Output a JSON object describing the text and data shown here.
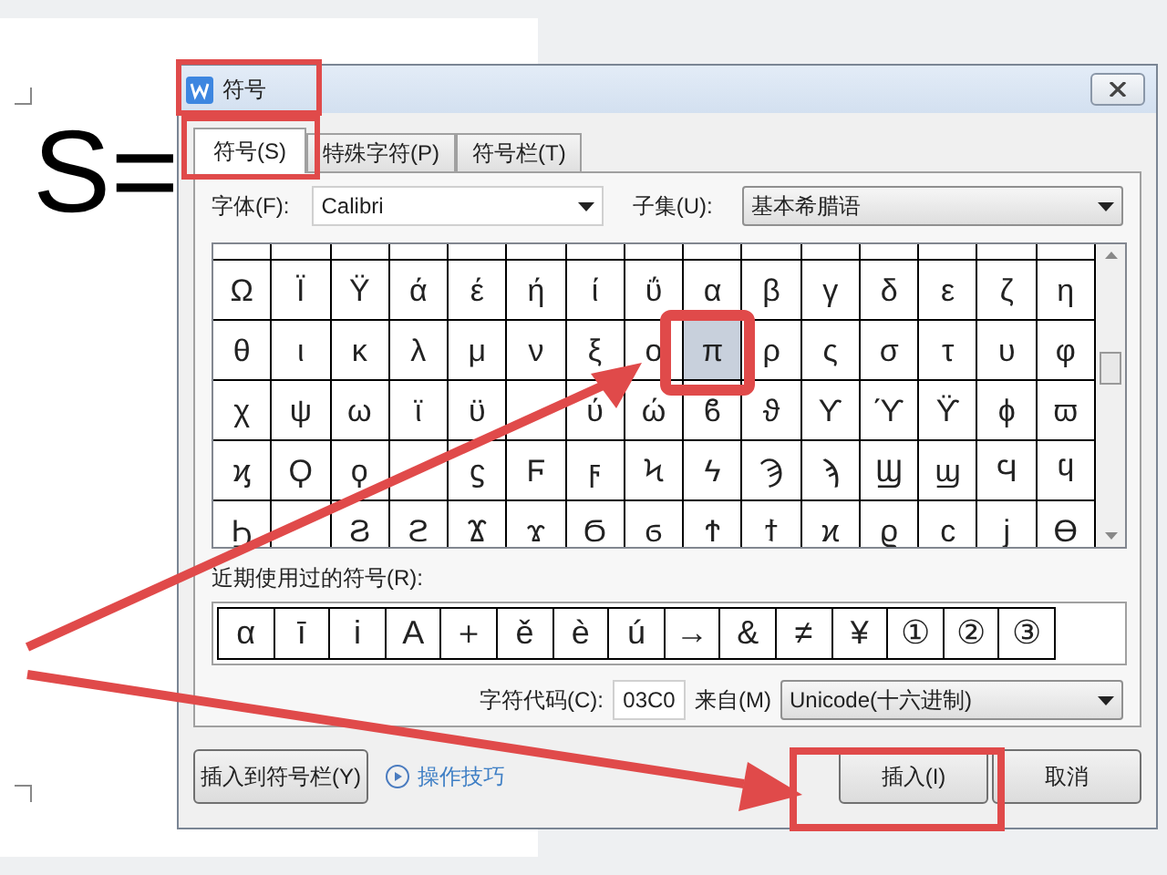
{
  "document": {
    "text": "S="
  },
  "window": {
    "title": "符号"
  },
  "tabs": [
    {
      "label": "符号(S)",
      "selected": true
    },
    {
      "label": "特殊字符(P)",
      "selected": false
    },
    {
      "label": "符号栏(T)",
      "selected": false
    }
  ],
  "font": {
    "label": "字体(F):",
    "value": "Calibri"
  },
  "subset": {
    "label": "子集(U):",
    "value": "基本希腊语"
  },
  "symbols": [
    [
      {
        "char": "Ω",
        "selected": false
      },
      {
        "char": "Ϊ",
        "selected": false
      },
      {
        "char": "Ϋ",
        "selected": false
      },
      {
        "char": "ά",
        "selected": false
      },
      {
        "char": "έ",
        "selected": false
      },
      {
        "char": "ή",
        "selected": false
      },
      {
        "char": "ί",
        "selected": false
      },
      {
        "char": "ΰ",
        "selected": false
      },
      {
        "char": "α",
        "selected": false
      },
      {
        "char": "β",
        "selected": false
      },
      {
        "char": "γ",
        "selected": false
      },
      {
        "char": "δ",
        "selected": false
      },
      {
        "char": "ε",
        "selected": false
      },
      {
        "char": "ζ",
        "selected": false
      },
      {
        "char": "η",
        "selected": false
      }
    ],
    [
      {
        "char": "θ",
        "selected": false
      },
      {
        "char": "ι",
        "selected": false
      },
      {
        "char": "κ",
        "selected": false
      },
      {
        "char": "λ",
        "selected": false
      },
      {
        "char": "μ",
        "selected": false
      },
      {
        "char": "ν",
        "selected": false
      },
      {
        "char": "ξ",
        "selected": false
      },
      {
        "char": "ο",
        "selected": false
      },
      {
        "char": "π",
        "selected": true
      },
      {
        "char": "ρ",
        "selected": false
      },
      {
        "char": "ς",
        "selected": false
      },
      {
        "char": "σ",
        "selected": false
      },
      {
        "char": "τ",
        "selected": false
      },
      {
        "char": "υ",
        "selected": false
      },
      {
        "char": "φ",
        "selected": false
      }
    ],
    [
      {
        "char": "χ",
        "selected": false
      },
      {
        "char": "ψ",
        "selected": false
      },
      {
        "char": "ω",
        "selected": false
      },
      {
        "char": "ϊ",
        "selected": false
      },
      {
        "char": "ϋ",
        "selected": false
      },
      {
        "selected": false
      },
      {
        "char": "ύ",
        "selected": false
      },
      {
        "char": "ώ",
        "selected": false
      },
      {
        "char": "ϐ",
        "selected": false
      },
      {
        "char": "ϑ",
        "selected": false
      },
      {
        "char": "ϒ",
        "selected": false
      },
      {
        "char": "ϓ",
        "selected": false
      },
      {
        "char": "ϔ",
        "selected": false
      },
      {
        "char": "ϕ",
        "selected": false
      },
      {
        "char": "ϖ",
        "selected": false
      }
    ],
    [
      {
        "char": "ϗ",
        "selected": false
      },
      {
        "char": "Ϙ",
        "selected": false
      },
      {
        "char": "ϙ",
        "selected": false
      },
      {
        "selected": false
      },
      {
        "char": "ϛ",
        "selected": false
      },
      {
        "char": "Ϝ",
        "selected": false
      },
      {
        "char": "ϝ",
        "selected": false
      },
      {
        "char": "Ϟ",
        "selected": false
      },
      {
        "char": "ϟ",
        "selected": false
      },
      {
        "char": "Ϡ",
        "selected": false
      },
      {
        "char": "ϡ",
        "selected": false
      },
      {
        "char": "Ϣ",
        "selected": false
      },
      {
        "char": "ϣ",
        "selected": false
      },
      {
        "char": "Ϥ",
        "selected": false
      },
      {
        "char": "ϥ",
        "selected": false
      }
    ],
    [
      {
        "char": "Ϧ",
        "selected": false
      },
      {
        "selected": false
      },
      {
        "char": "Ϩ",
        "selected": false
      },
      {
        "char": "ϩ",
        "selected": false
      },
      {
        "char": "Ϫ",
        "selected": false
      },
      {
        "char": "ϫ",
        "selected": false
      },
      {
        "char": "Ϭ",
        "selected": false
      },
      {
        "char": "ϭ",
        "selected": false
      },
      {
        "char": "Ϯ",
        "selected": false
      },
      {
        "char": "ϯ",
        "selected": false
      },
      {
        "char": "ϰ",
        "selected": false
      },
      {
        "char": "ϱ",
        "selected": false
      },
      {
        "char": "ϲ",
        "selected": false
      },
      {
        "char": "ϳ",
        "selected": false
      },
      {
        "char": "ϴ",
        "selected": false
      }
    ]
  ],
  "recent": {
    "label": "近期使用过的符号(R):",
    "symbols": [
      "α",
      "ī",
      "i",
      "A",
      "＋",
      "ě",
      "è",
      "ú",
      "→",
      "&",
      "≠",
      "¥",
      "①",
      "②",
      "③"
    ]
  },
  "char_code": {
    "label": "字符代码(C):",
    "value": "03C0"
  },
  "source": {
    "label": "来自(M)",
    "value": "Unicode(十六进制)"
  },
  "insert_to_bar": {
    "label": "插入到符号栏(Y)"
  },
  "tips_link": {
    "label": "操作技巧"
  },
  "insert": {
    "label": "插入(I)"
  },
  "cancel": {
    "label": "取消"
  }
}
